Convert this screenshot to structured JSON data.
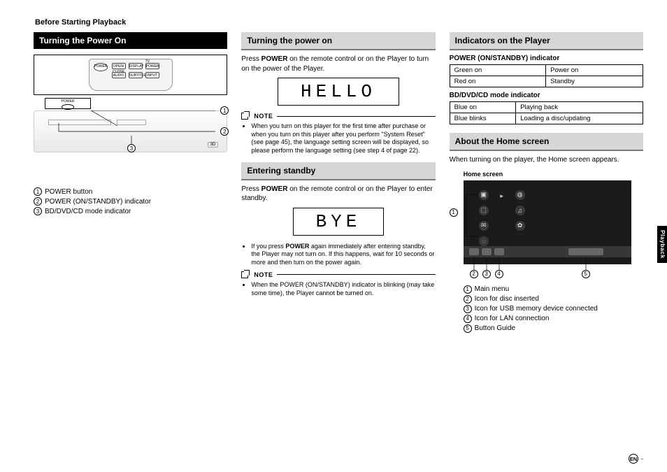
{
  "breadcrumb": "Before Starting Playback",
  "side_tab": "Playback",
  "page_code": "EN",
  "col1": {
    "heading": "Turning the Power On",
    "remote_buttons": {
      "power": "POWER",
      "open": "OPEN/\nCLOSE",
      "display": "DISPLAY",
      "tv_label": "TV",
      "tv_power": "POWER",
      "audio": "AUDIO",
      "subtitle": "SUBTITLE",
      "input": "INPUT"
    },
    "callout_label": "POWER",
    "legend": [
      {
        "num": "1",
        "text": "POWER button"
      },
      {
        "num": "2",
        "text": "POWER (ON/STANDBY) indicator"
      },
      {
        "num": "3",
        "text": "BD/DVD/CD mode indicator"
      }
    ]
  },
  "col2": {
    "sec1": {
      "heading": "Turning the power on",
      "para_pre": "Press ",
      "para_bold": "POWER",
      "para_post": " on the remote control or on the Player to turn on the power of the Player.",
      "lcd": "HELLO",
      "note_label": "NOTE",
      "note_bullet": "When you turn on this player for the first time after purchase or when you turn on this player after you perform \"System Reset\" (see page 45), the language setting screen will be displayed, so please perform the language setting (see step 4 of page 22)."
    },
    "sec2": {
      "heading": "Entering standby",
      "para_pre": "Press ",
      "para_bold": "POWER",
      "para_post": " on the remote control or on the Player to enter standby.",
      "lcd": "BYE",
      "bullet1_pre": "If you press ",
      "bullet1_bold": "POWER",
      "bullet1_post": " again immediately after entering standby, the Player may not turn on. If this happens, wait for 10 seconds or more and then turn on the power again.",
      "note_label": "NOTE",
      "bullet2": "When the POWER (ON/STANDBY) indicator is blinking (may take some time), the Player cannot be turned on."
    }
  },
  "col3": {
    "sec1": {
      "heading": "Indicators on the Player",
      "tbl1_caption": "POWER (ON/STANDBY) indicator",
      "tbl1": [
        [
          "Green on",
          "Power on"
        ],
        [
          "Red on",
          "Standby"
        ]
      ],
      "tbl2_caption": "BD/DVD/CD mode indicator",
      "tbl2": [
        [
          "Blue on",
          "Playing back"
        ],
        [
          "Blue blinks",
          "Loading a disc/updating"
        ]
      ]
    },
    "sec2": {
      "heading": "About the Home screen",
      "para": "When turning on the player, the Home screen appears.",
      "home_caption": "Home screen",
      "legend": [
        {
          "num": "1",
          "text": "Main menu"
        },
        {
          "num": "2",
          "text": "Icon for disc inserted"
        },
        {
          "num": "3",
          "text": "Icon for USB memory device connected"
        },
        {
          "num": "4",
          "text": "Icon for LAN connection"
        },
        {
          "num": "5",
          "text": "Button Guide"
        }
      ]
    }
  }
}
